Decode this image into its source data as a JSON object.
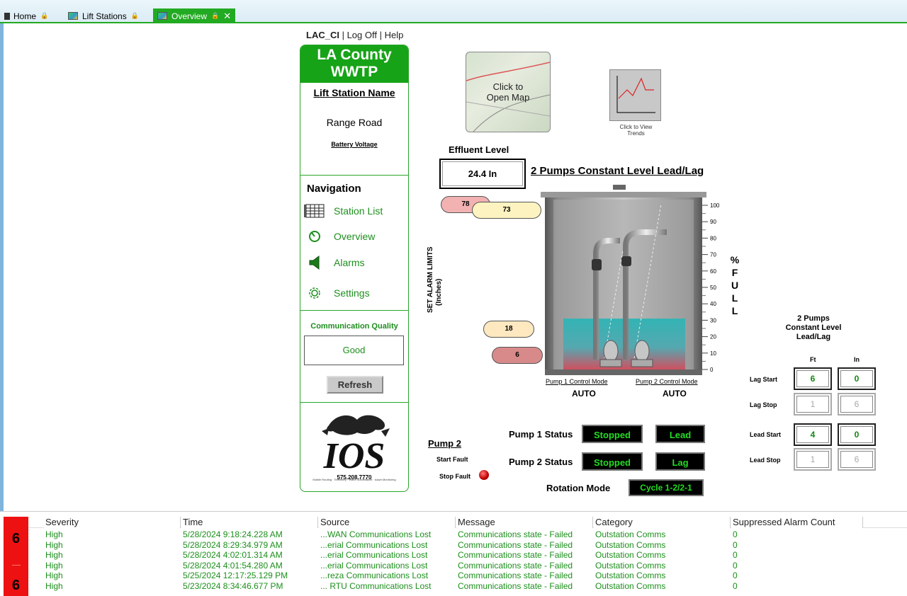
{
  "tabs": [
    {
      "label": "Home"
    },
    {
      "label": "Lift Stations"
    },
    {
      "label": "Overview",
      "active": true
    }
  ],
  "userbar": {
    "user": "LAC_CI",
    "sep1": " | ",
    "logoff": "Log Off",
    "sep2": " | ",
    "help": "Help"
  },
  "panel": {
    "title_line1": "LA County",
    "title_line2": "WWTP",
    "lift_station_heading": "Lift Station Name",
    "station_name": "Range Road",
    "battery_link": "Battery Voltage",
    "nav_title": "Navigation",
    "nav_items": [
      {
        "label": "Station List",
        "icon": "grid-icon"
      },
      {
        "label": "Overview",
        "icon": "gauge-icon"
      },
      {
        "label": "Alarms",
        "icon": "speaker-icon"
      },
      {
        "label": "Settings",
        "icon": "gear-icon"
      }
    ],
    "comm_quality_title": "Communication Quality",
    "comm_quality_value": "Good",
    "refresh_label": "Refresh",
    "logo_text": "IOS",
    "logo_tagline": "Mobile Routing · Telemetry · Video Surveillance · Asset Monitoring",
    "phone": "575.208.7770"
  },
  "map": {
    "label_line1": "Click to",
    "label_line2": "Open Map"
  },
  "trends": {
    "label_line1": "Click to View",
    "label_line2": "Trends"
  },
  "effluent": {
    "title": "Effluent Level",
    "value": "24.4 In"
  },
  "pump_config_title": "2 Pumps Constant Level Lead/Lag",
  "alarm_limits_label_line1": "SET ALARM LIMITS",
  "alarm_limits_label_line2": "(Inches)",
  "pct_full_letters": [
    "%",
    "F",
    "U",
    "L",
    "L"
  ],
  "tank": {
    "level_percent": 31,
    "scale_ticks": [
      "100",
      "90",
      "80",
      "70",
      "60",
      "50",
      "40",
      "30",
      "20",
      "10",
      "0"
    ],
    "limits": [
      {
        "value": "78",
        "color": "#f2b2b2"
      },
      {
        "value": "73",
        "color": "#fdf3c0"
      },
      {
        "value": "18",
        "color": "#fde8c0"
      },
      {
        "value": "6",
        "color": "#d88a8a"
      }
    ]
  },
  "pump1_mode": {
    "label": "Pump 1 Control Mode",
    "value": "AUTO"
  },
  "pump2_mode": {
    "label": "Pump 2 Control Mode",
    "value": "AUTO"
  },
  "setpoints": {
    "title_line1": "2 Pumps",
    "title_line2": "Constant Level",
    "title_line3": "Lead/Lag",
    "col_ft": "Ft",
    "col_in": "In",
    "rows": [
      {
        "label": "Lag Start",
        "ft": "6",
        "in": "0"
      },
      {
        "label": "Lag Stop",
        "ft": "1",
        "in": "6"
      },
      {
        "label": "Lead Start",
        "ft": "4",
        "in": "0"
      },
      {
        "label": "Lead Stop",
        "ft": "1",
        "in": "6"
      }
    ]
  },
  "pump2_faults": {
    "title": "Pump 2",
    "start_fault": "Start Fault",
    "stop_fault": "Stop Fault"
  },
  "pump_status": {
    "pump1_label": "Pump 1 Status",
    "pump1_state": "Stopped",
    "pump1_role": "Lead",
    "pump2_label": "Pump 2 Status",
    "pump2_state": "Stopped",
    "pump2_role": "Lag",
    "rotation_label": "Rotation Mode",
    "rotation_value": "Cycle 1-2/2-1"
  },
  "alarms": {
    "severity_counts": [
      "6",
      "6"
    ],
    "columns": [
      "Severity",
      "Time",
      "Source",
      "Message",
      "Category",
      "Suppressed Alarm Count"
    ],
    "rows": [
      [
        "High",
        "5/28/2024 9:18:24.228 AM",
        "...WAN Communications Lost",
        "Communications state - Failed",
        "Outstation Comms",
        "0"
      ],
      [
        "High",
        "5/28/2024 8:29:34.979 AM",
        "...erial Communications Lost",
        "Communications state - Failed",
        "Outstation Comms",
        "0"
      ],
      [
        "High",
        "5/28/2024 4:02:01.314 AM",
        "...erial Communications Lost",
        "Communications state - Failed",
        "Outstation Comms",
        "0"
      ],
      [
        "High",
        "5/28/2024 4:01:54.280 AM",
        "...erial Communications Lost",
        "Communications state - Failed",
        "Outstation Comms",
        "0"
      ],
      [
        "High",
        "5/25/2024 12:17:25.129 PM",
        "...reza Communications Lost",
        "Communications state - Failed",
        "Outstation Comms",
        "0"
      ],
      [
        "High",
        "5/23/2024 8:34:46.677 PM",
        "... RTU Communications Lost",
        "Communications state - Failed",
        "Outstation Comms",
        "0"
      ]
    ]
  }
}
